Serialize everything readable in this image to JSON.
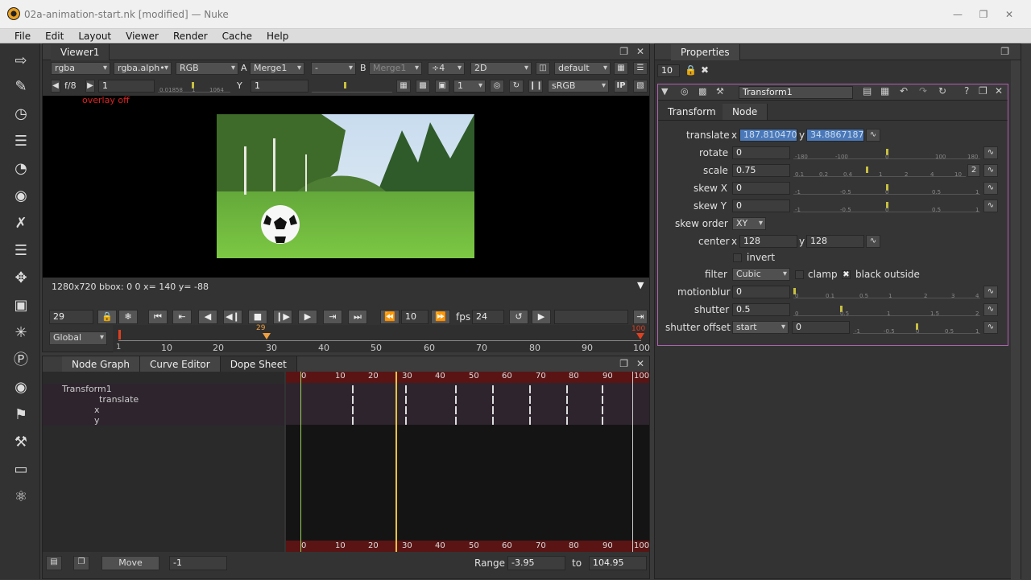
{
  "window": {
    "title": "02a-animation-start.nk [modified] — Nuke"
  },
  "menu": [
    "File",
    "Edit",
    "Layout",
    "Viewer",
    "Render",
    "Cache",
    "Help"
  ],
  "viewer": {
    "tab": "Viewer1",
    "row1": {
      "channels": "rgba",
      "alpha": "rgba.alph•",
      "display": "RGB",
      "a_label": "A",
      "a_input": "Merge1",
      "op": "-",
      "b_label": "B",
      "b_input": "Merge1",
      "downrez": "÷4",
      "mode": "2D",
      "lut": "default"
    },
    "row2": {
      "fstop": "f/8",
      "gain": "1",
      "gamma_label": "Y",
      "gamma": "1",
      "proxy": "1",
      "colorspace": "sRGB",
      "ip": "IP"
    },
    "overlay": "overlay off",
    "status": "1280x720 bbox: 0 0  x= 140 y= -88",
    "gain_ticks": [
      "0.01858",
      "1",
      "1064"
    ],
    "frame": "29",
    "step": "10",
    "fps_label": "fps",
    "fps": "24",
    "range_mode": "Global",
    "timeline_ticks": [
      "1",
      "10",
      "20",
      "30",
      "40",
      "50",
      "60",
      "70",
      "80",
      "90",
      "100"
    ],
    "current_frame_marker": "29",
    "end_marker": "100"
  },
  "nodegraph": {
    "tabs": [
      "Node Graph",
      "Curve Editor",
      "Dope Sheet"
    ],
    "tree": [
      "Transform1",
      "translate",
      "x",
      "y"
    ],
    "ruler": [
      "0",
      "10",
      "20",
      "30",
      "40",
      "50",
      "60",
      "70",
      "80",
      "90",
      "100"
    ],
    "bottom": {
      "move_label": "Move",
      "move_value": "-1",
      "range_label": "Range",
      "range_from": "-3.95",
      "to_label": "to",
      "range_to": "104.95"
    }
  },
  "properties": {
    "tab": "Properties",
    "max_panels": "10",
    "node_name": "Transform1",
    "subtabs": [
      "Transform",
      "Node"
    ],
    "translate": {
      "label": "translate",
      "x_label": "x",
      "x": "187.810470",
      "y_label": "y",
      "y": "34.8867187"
    },
    "rotate": {
      "label": "rotate",
      "value": "0",
      "ticks": [
        "-180",
        "-100",
        "0",
        "100",
        "180"
      ]
    },
    "scale": {
      "label": "scale",
      "value": "0.75",
      "ticks": [
        "0.1",
        "0.2",
        "0.4",
        "1",
        "2",
        "4",
        "10"
      ],
      "badge": "2"
    },
    "skewx": {
      "label": "skew X",
      "value": "0",
      "ticks": [
        "-1",
        "-0.5",
        "0",
        "0.5",
        "1"
      ]
    },
    "skewy": {
      "label": "skew Y",
      "value": "0",
      "ticks": [
        "-1",
        "-0.5",
        "0",
        "0.5",
        "1"
      ]
    },
    "skew_order": {
      "label": "skew order",
      "value": "XY"
    },
    "center": {
      "label": "center",
      "x_label": "x",
      "x": "128",
      "y_label": "y",
      "y": "128"
    },
    "invert": "invert",
    "filter": {
      "label": "filter",
      "value": "Cubic",
      "clamp": "clamp",
      "black_outside": "black outside"
    },
    "motionblur": {
      "label": "motionblur",
      "value": "0",
      "ticks": [
        "0",
        "0.1",
        "0.5",
        "1",
        "2",
        "3",
        "4"
      ]
    },
    "shutter": {
      "label": "shutter",
      "value": "0.5",
      "ticks": [
        "0",
        "0.5",
        "1",
        "1.5",
        "2"
      ]
    },
    "shutter_offset": {
      "label": "shutter offset",
      "mode": "start",
      "value": "0",
      "ticks": [
        "-1",
        "-0.5",
        "0",
        "0.5",
        "1"
      ]
    }
  }
}
